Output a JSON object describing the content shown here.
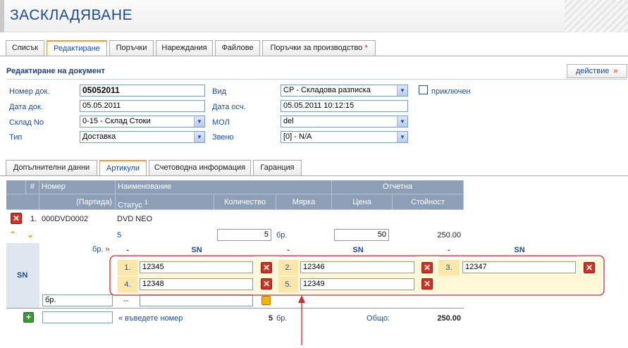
{
  "page_title": "ЗАСКЛАДЯВАНЕ",
  "main_tabs": [
    {
      "label": "Списък"
    },
    {
      "label": "Редактиране",
      "active": true
    },
    {
      "label": "Поръчки"
    },
    {
      "label": "Нареждания"
    },
    {
      "label": "Файлове"
    },
    {
      "label": "Поръчки за производство",
      "star": "*"
    }
  ],
  "panel": {
    "title": "Редактиране на документ",
    "action_label": "действие",
    "action_icon": "»"
  },
  "form": {
    "doc_no_label": "Номер док.",
    "doc_no_value": "05052011",
    "doc_date_label": "Дата док.",
    "doc_date_value": "05.05.2011",
    "warehouse_label": "Склад No",
    "warehouse_value": "0-15 - Склад Стоки",
    "type_label": "Тип",
    "type_value": "Доставка",
    "kind_label": "Вид",
    "kind_value": "СР - Складова разписка",
    "closed_label": "приключен",
    "closed_checked": false,
    "post_date_label": "Дата осч.",
    "post_date_value": "05.05.2011 10:12:15",
    "mol_label": "МОЛ",
    "mol_value": "del",
    "unit_label": "Звено",
    "unit_value": "[0] - N/A"
  },
  "sub_tabs": [
    {
      "label": "Допълнителни данни"
    },
    {
      "label": "Артикули",
      "active": true
    },
    {
      "label": "Счетоводна информация"
    },
    {
      "label": "Гаранция"
    }
  ],
  "grid": {
    "headers": {
      "hash": "#",
      "number": "Номер",
      "name": "Наименование",
      "reporting": "Отчетна",
      "batch": "(Партида)",
      "status": "Статус",
      "status_sup": "1",
      "quantity": "Количество",
      "unit": "Мярка",
      "price": "Цена",
      "value": "Стойност"
    },
    "row": {
      "index": "1.",
      "number": "000DVD0002",
      "name": "DVD NEO",
      "status": "5",
      "quantity": "5",
      "unit": "бр.",
      "price": "50",
      "value": "250.00"
    },
    "sn": {
      "label": "SN",
      "unit_link": "бр.",
      "unit_link_icon": "»",
      "col_dash": "-",
      "col_header": "SN",
      "items": [
        {
          "idx": "1.",
          "value": "12345"
        },
        {
          "idx": "2.",
          "value": "12346"
        },
        {
          "idx": "3.",
          "value": "12347"
        },
        {
          "idx": "4.",
          "value": "12348"
        },
        {
          "idx": "5.",
          "value": "12349"
        }
      ],
      "new_unit": "бр.",
      "new_dash": "--"
    },
    "footer": {
      "enter_number": "« въведете номер",
      "qty": "5",
      "unit": "бр.",
      "total_label": "Общо:",
      "total": "250.00"
    }
  },
  "colors": {
    "accent_blue": "#1a4c94",
    "header_gray_blue": "#8c9fb6",
    "highlight_yellow": "#fde7a8",
    "annotation_red": "#d9262b"
  }
}
